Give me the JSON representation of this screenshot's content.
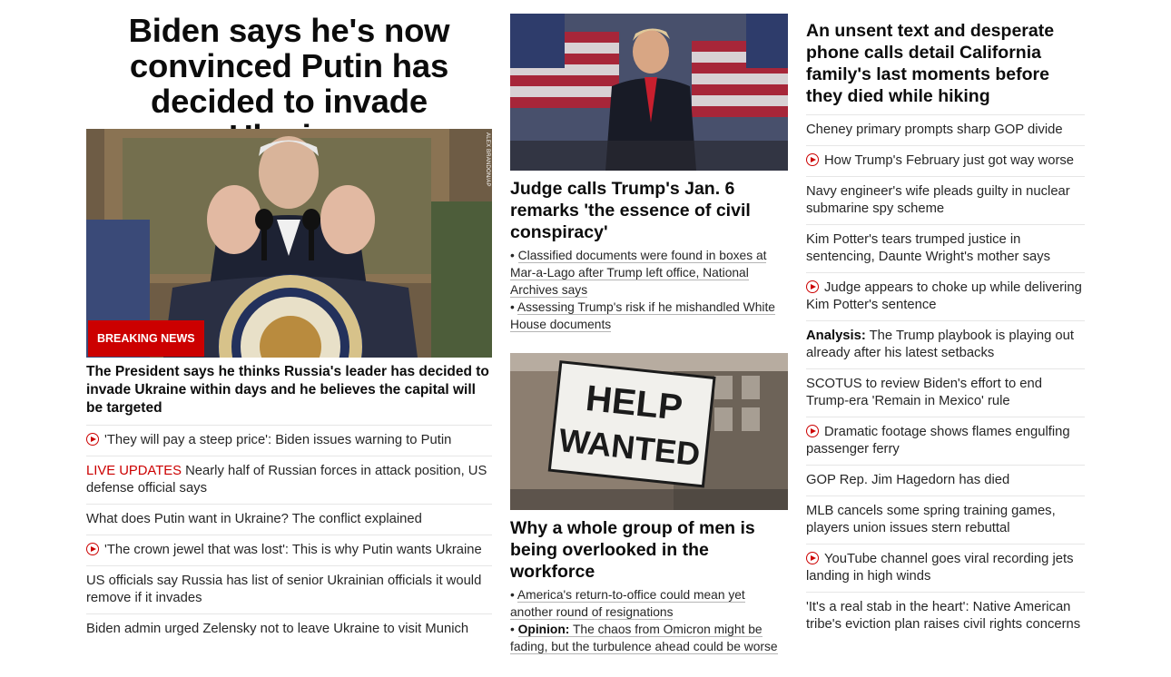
{
  "col1": {
    "headline": "Biden says he's now convinced Putin has decided to invade Ukraine",
    "image_credit": "ALEX BRANDON/AP",
    "badge": "BREAKING NEWS",
    "caption": "The President says he thinks Russia's leader has decided to invade Ukraine within days and he believes the capital will be targeted",
    "items": [
      {
        "video": true,
        "text": "'They will pay a steep price': Biden issues warning to Putin"
      },
      {
        "live": "LIVE UPDATES",
        "text": " Nearly half of Russian forces in attack position, US defense official says"
      },
      {
        "text": "What does Putin want in Ukraine? The conflict explained"
      },
      {
        "video": true,
        "text": "'The crown jewel that was lost': This is why Putin wants Ukraine"
      },
      {
        "text": "US officials say Russia has list of senior Ukrainian officials it would remove if it invades"
      },
      {
        "text": "Biden admin urged Zelensky not to leave Ukraine to visit Munich"
      }
    ]
  },
  "col2": {
    "story1": {
      "headline": "Judge calls Trump's Jan. 6 remarks 'the essence of civil conspiracy'",
      "links": [
        "Classified documents were found in boxes at Mar-a-Lago after Trump left office, National Archives says",
        "Assessing Trump's risk if he mishandled White House documents"
      ]
    },
    "story2": {
      "image_text_1": "HELP",
      "image_text_2": "WANTED",
      "headline": "Why a whole group of men is being overlooked in the workforce",
      "link1": "America's return-to-office could mean yet another round of resignations",
      "link2_prefix": "Opinion:",
      "link2": " The chaos from Omicron might be fading, but the turbulence ahead could be worse"
    }
  },
  "col3": {
    "headline": "An unsent text and desperate phone calls detail California family's last moments before they died while hiking",
    "items": [
      {
        "text": "Cheney primary prompts sharp GOP divide"
      },
      {
        "video": true,
        "text": "How Trump's February just got way worse"
      },
      {
        "text": "Navy engineer's wife pleads guilty in nuclear submarine spy scheme"
      },
      {
        "text": "Kim Potter's tears trumped justice in sentencing, Daunte Wright's mother says"
      },
      {
        "video": true,
        "text": "Judge appears to choke up while delivering Kim Potter's sentence"
      },
      {
        "prefix": "Analysis:",
        "text": " The Trump playbook is playing out already after his latest setbacks"
      },
      {
        "text": "SCOTUS to review Biden's effort to end Trump-era 'Remain in Mexico' rule"
      },
      {
        "video": true,
        "text": "Dramatic footage shows flames engulfing passenger ferry"
      },
      {
        "text": "GOP Rep. Jim Hagedorn has died"
      },
      {
        "text": "MLB cancels some spring training games, players union issues stern rebuttal"
      },
      {
        "video": true,
        "text": "YouTube channel goes viral recording jets landing in high winds"
      },
      {
        "text": "'It's a real stab in the heart': Native American tribe's eviction plan raises civil rights concerns"
      }
    ]
  },
  "colors": {
    "accent_red": "#cc0000",
    "text": "#0c0c0c",
    "divider": "#e6e6e6"
  }
}
